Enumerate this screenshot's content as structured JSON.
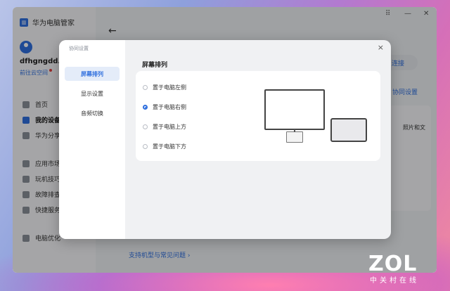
{
  "app": {
    "title": "华为电脑管家",
    "window_controls": [
      "⠿",
      "—",
      "✕"
    ],
    "username": "dfhgngdd...",
    "cloud_link": "前往云空间",
    "nav": [
      {
        "label": "首页"
      },
      {
        "label": "我的设备"
      },
      {
        "label": "华为分享"
      },
      {
        "label": "应用市场"
      },
      {
        "label": "玩机技巧"
      },
      {
        "label": "故障排查"
      },
      {
        "label": "快捷服务"
      },
      {
        "label": "电脑优化"
      }
    ],
    "connect_button": "连接",
    "coop_link": "协同设置",
    "side_text": "照片和文",
    "faq_link": "支持机型与常见问题 ›"
  },
  "dialog": {
    "title": "协同设置",
    "close": "×",
    "tabs": [
      {
        "label": "屏幕排列",
        "active": true
      },
      {
        "label": "显示设置",
        "active": false
      },
      {
        "label": "音频切换",
        "active": false
      }
    ],
    "section_title": "屏幕排列",
    "options": [
      {
        "label": "置于电脑左侧",
        "selected": false
      },
      {
        "label": "置于电脑右侧",
        "selected": true
      },
      {
        "label": "置于电脑上方",
        "selected": false
      },
      {
        "label": "置于电脑下方",
        "selected": false
      }
    ]
  },
  "watermark": {
    "logo": "ZOL",
    "sub": "中关村在线"
  },
  "colors": {
    "accent": "#2f6fde"
  }
}
